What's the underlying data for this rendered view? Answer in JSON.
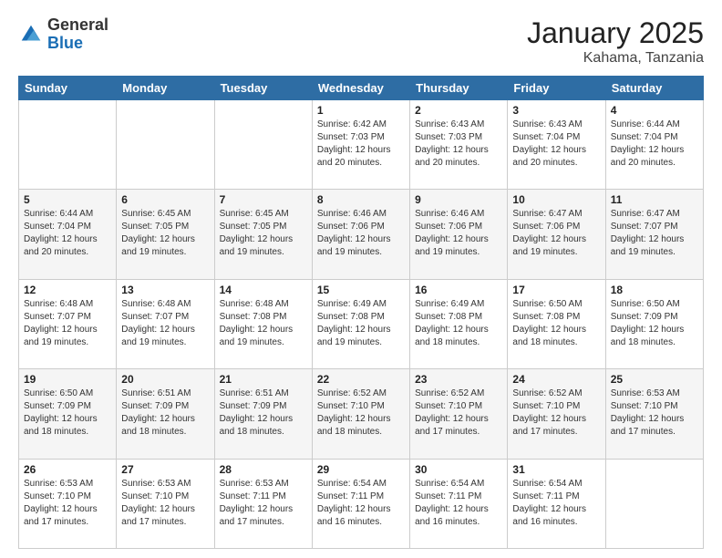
{
  "header": {
    "logo_general": "General",
    "logo_blue": "Blue",
    "month_title": "January 2025",
    "location": "Kahama, Tanzania"
  },
  "days_of_week": [
    "Sunday",
    "Monday",
    "Tuesday",
    "Wednesday",
    "Thursday",
    "Friday",
    "Saturday"
  ],
  "weeks": [
    [
      {
        "day": "",
        "info": ""
      },
      {
        "day": "",
        "info": ""
      },
      {
        "day": "",
        "info": ""
      },
      {
        "day": "1",
        "info": "Sunrise: 6:42 AM\nSunset: 7:03 PM\nDaylight: 12 hours and 20 minutes."
      },
      {
        "day": "2",
        "info": "Sunrise: 6:43 AM\nSunset: 7:03 PM\nDaylight: 12 hours and 20 minutes."
      },
      {
        "day": "3",
        "info": "Sunrise: 6:43 AM\nSunset: 7:04 PM\nDaylight: 12 hours and 20 minutes."
      },
      {
        "day": "4",
        "info": "Sunrise: 6:44 AM\nSunset: 7:04 PM\nDaylight: 12 hours and 20 minutes."
      }
    ],
    [
      {
        "day": "5",
        "info": "Sunrise: 6:44 AM\nSunset: 7:04 PM\nDaylight: 12 hours and 20 minutes."
      },
      {
        "day": "6",
        "info": "Sunrise: 6:45 AM\nSunset: 7:05 PM\nDaylight: 12 hours and 19 minutes."
      },
      {
        "day": "7",
        "info": "Sunrise: 6:45 AM\nSunset: 7:05 PM\nDaylight: 12 hours and 19 minutes."
      },
      {
        "day": "8",
        "info": "Sunrise: 6:46 AM\nSunset: 7:06 PM\nDaylight: 12 hours and 19 minutes."
      },
      {
        "day": "9",
        "info": "Sunrise: 6:46 AM\nSunset: 7:06 PM\nDaylight: 12 hours and 19 minutes."
      },
      {
        "day": "10",
        "info": "Sunrise: 6:47 AM\nSunset: 7:06 PM\nDaylight: 12 hours and 19 minutes."
      },
      {
        "day": "11",
        "info": "Sunrise: 6:47 AM\nSunset: 7:07 PM\nDaylight: 12 hours and 19 minutes."
      }
    ],
    [
      {
        "day": "12",
        "info": "Sunrise: 6:48 AM\nSunset: 7:07 PM\nDaylight: 12 hours and 19 minutes."
      },
      {
        "day": "13",
        "info": "Sunrise: 6:48 AM\nSunset: 7:07 PM\nDaylight: 12 hours and 19 minutes."
      },
      {
        "day": "14",
        "info": "Sunrise: 6:48 AM\nSunset: 7:08 PM\nDaylight: 12 hours and 19 minutes."
      },
      {
        "day": "15",
        "info": "Sunrise: 6:49 AM\nSunset: 7:08 PM\nDaylight: 12 hours and 19 minutes."
      },
      {
        "day": "16",
        "info": "Sunrise: 6:49 AM\nSunset: 7:08 PM\nDaylight: 12 hours and 18 minutes."
      },
      {
        "day": "17",
        "info": "Sunrise: 6:50 AM\nSunset: 7:08 PM\nDaylight: 12 hours and 18 minutes."
      },
      {
        "day": "18",
        "info": "Sunrise: 6:50 AM\nSunset: 7:09 PM\nDaylight: 12 hours and 18 minutes."
      }
    ],
    [
      {
        "day": "19",
        "info": "Sunrise: 6:50 AM\nSunset: 7:09 PM\nDaylight: 12 hours and 18 minutes."
      },
      {
        "day": "20",
        "info": "Sunrise: 6:51 AM\nSunset: 7:09 PM\nDaylight: 12 hours and 18 minutes."
      },
      {
        "day": "21",
        "info": "Sunrise: 6:51 AM\nSunset: 7:09 PM\nDaylight: 12 hours and 18 minutes."
      },
      {
        "day": "22",
        "info": "Sunrise: 6:52 AM\nSunset: 7:10 PM\nDaylight: 12 hours and 18 minutes."
      },
      {
        "day": "23",
        "info": "Sunrise: 6:52 AM\nSunset: 7:10 PM\nDaylight: 12 hours and 17 minutes."
      },
      {
        "day": "24",
        "info": "Sunrise: 6:52 AM\nSunset: 7:10 PM\nDaylight: 12 hours and 17 minutes."
      },
      {
        "day": "25",
        "info": "Sunrise: 6:53 AM\nSunset: 7:10 PM\nDaylight: 12 hours and 17 minutes."
      }
    ],
    [
      {
        "day": "26",
        "info": "Sunrise: 6:53 AM\nSunset: 7:10 PM\nDaylight: 12 hours and 17 minutes."
      },
      {
        "day": "27",
        "info": "Sunrise: 6:53 AM\nSunset: 7:10 PM\nDaylight: 12 hours and 17 minutes."
      },
      {
        "day": "28",
        "info": "Sunrise: 6:53 AM\nSunset: 7:11 PM\nDaylight: 12 hours and 17 minutes."
      },
      {
        "day": "29",
        "info": "Sunrise: 6:54 AM\nSunset: 7:11 PM\nDaylight: 12 hours and 16 minutes."
      },
      {
        "day": "30",
        "info": "Sunrise: 6:54 AM\nSunset: 7:11 PM\nDaylight: 12 hours and 16 minutes."
      },
      {
        "day": "31",
        "info": "Sunrise: 6:54 AM\nSunset: 7:11 PM\nDaylight: 12 hours and 16 minutes."
      },
      {
        "day": "",
        "info": ""
      }
    ]
  ]
}
